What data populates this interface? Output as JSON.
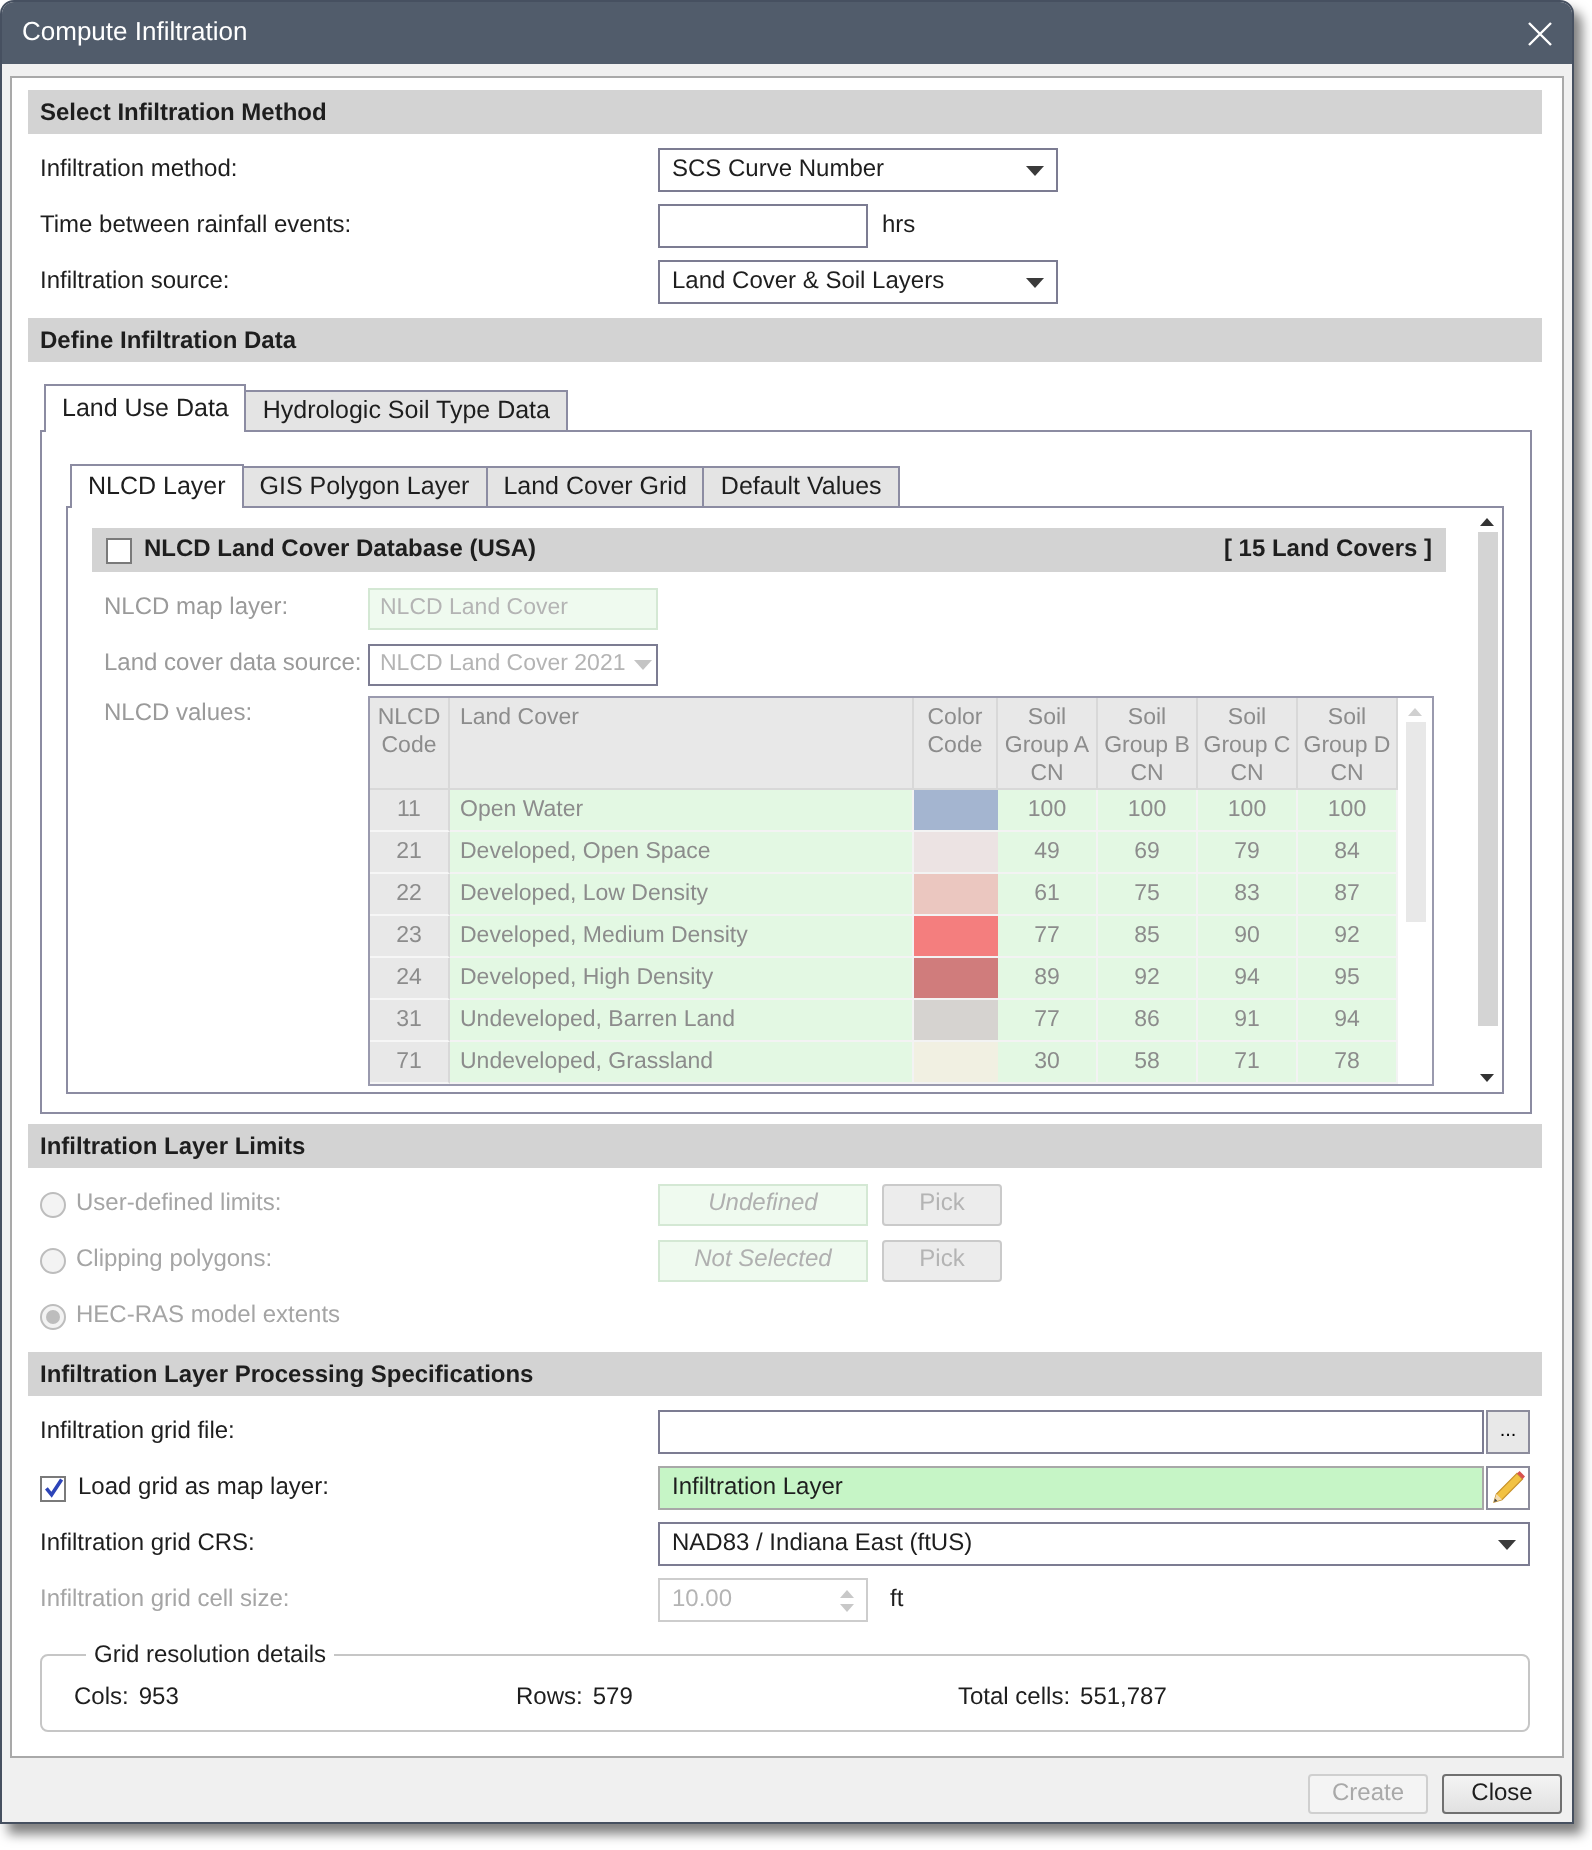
{
  "window": {
    "title": "Compute Infiltration"
  },
  "method_section": {
    "title": "Select Infiltration Method",
    "fields": [
      {
        "kind": "select",
        "label": "Infiltration method:",
        "value": "SCS Curve Number"
      },
      {
        "kind": "input",
        "label": "Time between rainfall events:",
        "unit": "hrs"
      },
      {
        "kind": "select",
        "label": "Infiltration source:",
        "value": "Land Cover & Soil Layers"
      }
    ]
  },
  "data_section": {
    "title": "Define Infiltration Data",
    "tabs": [
      {
        "label": "Land Use Data",
        "selected": true
      },
      {
        "label": "Hydrologic Soil Type Data",
        "selected": false
      }
    ],
    "subtabs": [
      {
        "label": "NLCD Layer",
        "selected": true
      },
      {
        "label": "GIS Polygon Layer",
        "selected": false
      },
      {
        "label": "Land Cover Grid",
        "selected": false
      },
      {
        "label": "Default Values",
        "selected": false
      }
    ],
    "nlcd": {
      "title": "NLCD Land Cover Database (USA)",
      "checked": false,
      "count": "[ 15 Land Covers ]",
      "fields": [
        {
          "kind": "text",
          "label": "NLCD map layer:",
          "value": "NLCD Land Cover"
        },
        {
          "kind": "select",
          "label": "Land cover data source:",
          "value": "NLCD Land Cover 2021"
        }
      ],
      "table_label": "NLCD values:",
      "table": {
        "columns": [
          "NLCD Code",
          "Land Cover",
          "Color Code",
          "Soil Group A CN",
          "Soil Group B CN",
          "Soil Group C CN",
          "Soil Group D CN"
        ],
        "rows": [
          {
            "code": "11",
            "land_cover": "Open Water",
            "color": "#a4b5d0",
            "cn": [
              "100",
              "100",
              "100",
              "100"
            ]
          },
          {
            "code": "21",
            "land_cover": "Developed, Open Space",
            "color": "#ece3e3",
            "cn": [
              "49",
              "69",
              "79",
              "84"
            ]
          },
          {
            "code": "22",
            "land_cover": "Developed, Low Density",
            "color": "#ebc7c0",
            "cn": [
              "61",
              "75",
              "83",
              "87"
            ]
          },
          {
            "code": "23",
            "land_cover": "Developed, Medium Density",
            "color": "#f47e7e",
            "cn": [
              "77",
              "85",
              "90",
              "92"
            ]
          },
          {
            "code": "24",
            "land_cover": "Developed, High Density",
            "color": "#d07c7c",
            "cn": [
              "89",
              "92",
              "94",
              "95"
            ]
          },
          {
            "code": "31",
            "land_cover": "Undeveloped, Barren Land",
            "color": "#d6d3d0",
            "cn": [
              "77",
              "86",
              "91",
              "94"
            ]
          },
          {
            "code": "71",
            "land_cover": "Undeveloped, Grassland",
            "color": "#f1f0e2",
            "cn": [
              "30",
              "58",
              "71",
              "78"
            ]
          }
        ]
      }
    }
  },
  "limits_section": {
    "title": "Infiltration Layer Limits",
    "options": [
      {
        "label": "User-defined limits:",
        "selected": false,
        "disabled": true,
        "value": "Undefined",
        "button": "Pick"
      },
      {
        "label": "Clipping polygons:",
        "selected": false,
        "disabled": true,
        "value": "Not Selected",
        "button": "Pick"
      },
      {
        "label": "HEC-RAS model extents",
        "selected": true,
        "disabled": true
      }
    ]
  },
  "processing_section": {
    "title": "Infiltration Layer Processing Specifications",
    "fields": [
      {
        "kind": "file",
        "label": "Infiltration grid file:",
        "button": "...",
        "disabled": false
      },
      {
        "kind": "layer",
        "label": "Load grid as map layer:",
        "checked": true,
        "value": "Infiltration Layer",
        "disabled": false
      },
      {
        "kind": "select",
        "label": "Infiltration grid CRS:",
        "value": "NAD83 / Indiana East (ftUS)",
        "disabled": false
      },
      {
        "kind": "spin",
        "label": "Infiltration grid cell size:",
        "value": "10.00",
        "unit": "ft",
        "disabled": true
      }
    ],
    "grid_details": {
      "title": "Grid resolution details",
      "items": [
        {
          "label": "Cols:",
          "value": "953"
        },
        {
          "label": "Rows:",
          "value": "579"
        },
        {
          "label": "Total cells:",
          "value": "551,787"
        }
      ]
    }
  },
  "buttons": [
    {
      "label": "Create",
      "disabled": true
    },
    {
      "label": "Close",
      "disabled": false
    }
  ]
}
